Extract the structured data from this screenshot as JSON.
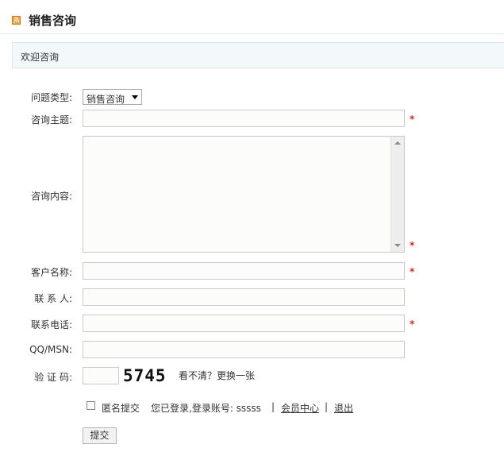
{
  "header": {
    "title": "销售咨询",
    "icon": "rss-icon"
  },
  "welcome": {
    "text": "欢迎咨询"
  },
  "form": {
    "type_label": "问题类型:",
    "type_value": "销售咨询",
    "subject_label": "咨询主题:",
    "content_label": "咨询内容:",
    "customer_label": "客户名称:",
    "contact_label": "联 系 人:",
    "phone_label": "联系电话:",
    "qq_label": "QQ/MSN:",
    "captcha_label": "验 证 码:",
    "required_mark": "*",
    "captcha_code": "5745",
    "captcha_refresh": "看不清？更换一张"
  },
  "footer": {
    "anonymous_label": "匿名提交",
    "logged_in_text": "您已登录,登录账号: sssss",
    "separator": "|",
    "member_center": "会员中心",
    "logout": "退出",
    "submit_label": "提交"
  },
  "colors": {
    "accent_icon": "#f3a13b",
    "required": "#e2231a",
    "welcome_bg": "#f3f9fb"
  }
}
